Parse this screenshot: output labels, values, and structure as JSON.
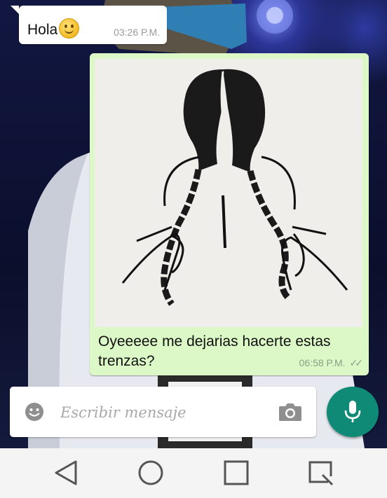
{
  "chat": {
    "messages": [
      {
        "direction": "incoming",
        "text": "Hola",
        "emoji": "slightly-smiling-face",
        "time": "03:26 P.M."
      },
      {
        "direction": "outgoing",
        "attachment": "photo",
        "caption": "Oyeeeee me dejarias hacerte estas trenzas?",
        "time": "06:58 P.M.",
        "status": "read-double-check"
      }
    ]
  },
  "composer": {
    "placeholder": "Escribir mensaje",
    "value": "",
    "icons": {
      "emoji": "smiley-icon",
      "camera": "camera-icon",
      "send": "microphone-icon"
    }
  },
  "navbar": {
    "icons": [
      "back-triangle-icon",
      "home-circle-icon",
      "recents-square-icon",
      "screenshot-icon"
    ]
  },
  "colors": {
    "incoming_bubble": "#ffffff",
    "outgoing_bubble": "#dcf8c6",
    "accent": "#0e8a76",
    "navbar": "#f4f4f4"
  }
}
